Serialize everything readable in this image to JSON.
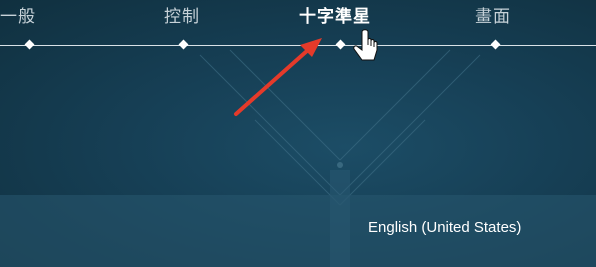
{
  "tabs": [
    {
      "label": "一般",
      "active": false
    },
    {
      "label": "控制",
      "active": false
    },
    {
      "label": "十字準星",
      "active": true
    },
    {
      "label": "畫面",
      "active": false
    }
  ],
  "language": {
    "value": "English (United States)"
  },
  "colors": {
    "background": "#14394d",
    "annotation_arrow": "#e53a2a",
    "text_active": "#ffffff",
    "text_inactive": "#c7d2d8"
  },
  "icons": [
    "arrow-annotation-icon",
    "hand-pointer-cursor-icon"
  ]
}
